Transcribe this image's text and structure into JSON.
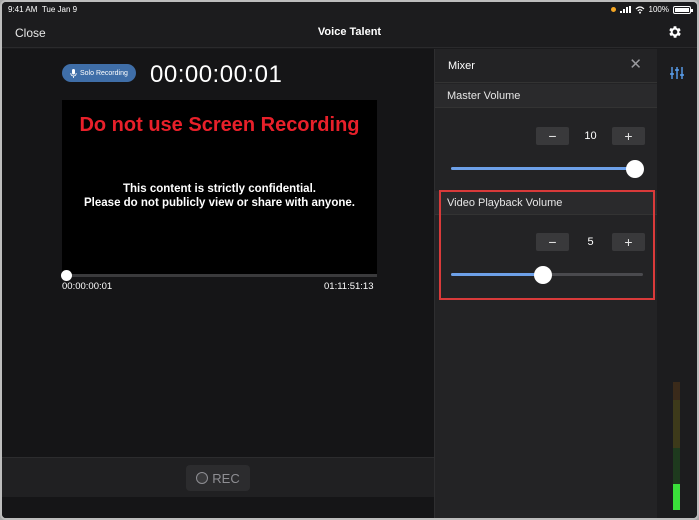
{
  "status_bar": {
    "time": "9:41 AM",
    "date": "Tue Jan 9",
    "battery": "100%"
  },
  "nav": {
    "close_label": "Close",
    "title": "Voice Talent",
    "settings_icon": "gear-icon"
  },
  "recording": {
    "solo_label": "Solo Recording",
    "timecode": "00:00:00:01",
    "video_warning": "Do not use Screen Recording",
    "confidential_line1": "This content is strictly confidential.",
    "confidential_line2": "Please do not publicly view or share with anyone.",
    "scrub_position": 0.0,
    "start_time": "00:00:00:01",
    "end_time": "01:11:51:13",
    "rec_label": "REC"
  },
  "mixer": {
    "title": "Mixer",
    "master": {
      "label": "Master Volume",
      "value": "10",
      "level": 1.0,
      "minus": "−",
      "plus": "+"
    },
    "video_playback": {
      "label": "Video Playback Volume",
      "value": "5",
      "level": 0.5,
      "minus": "−",
      "plus": "+"
    }
  },
  "colors": {
    "accent": "#6da0e8",
    "warning": "#e8202a",
    "highlight": "#d93a3a",
    "solo_badge": "#3f6ea8"
  }
}
